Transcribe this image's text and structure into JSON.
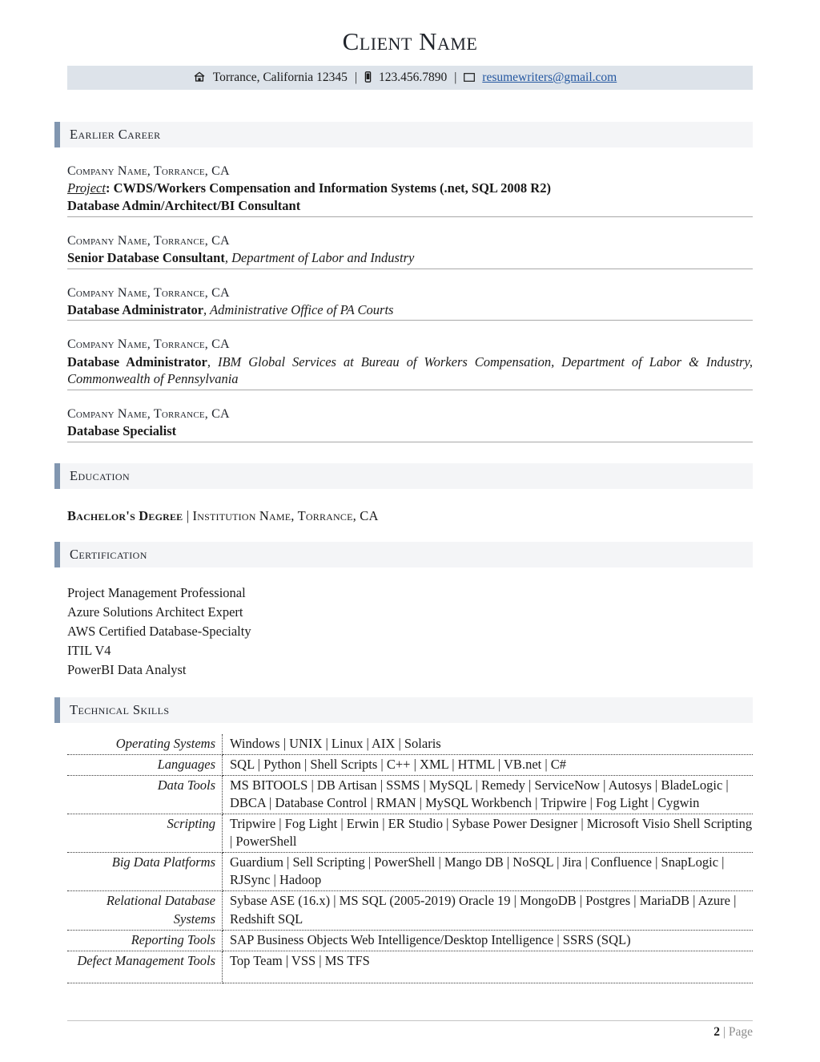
{
  "header": {
    "name": "Client Name",
    "contact": {
      "address": "Torrance, California 12345",
      "address_icon": "home-icon",
      "phone": "123.456.7890",
      "phone_icon": "mobile-phone-icon",
      "email": "resumewriters@gmail.com",
      "email_icon": "envelope-icon",
      "separator": "|"
    },
    "accent_color": "#8196b0",
    "band_color": "#dde3ea",
    "link_color": "#2457a0"
  },
  "sections": {
    "earlier_career": "Earlier Career",
    "education": "Education",
    "certification": "Certification",
    "technical_skills": "Technical Skills"
  },
  "jobs": [
    {
      "company": "Company Name, Torrance, CA",
      "project_label": "Project",
      "project": ": CWDS/Workers Compensation and Information Systems (.net, SQL 2008 R2)",
      "title": "Database Admin/Architect/BI Consultant",
      "department": ""
    },
    {
      "company": "Company Name, Torrance, CA",
      "project_label": "",
      "project": "",
      "title": "Senior Database Consultant",
      "department": ", Department of Labor and Industry"
    },
    {
      "company": "Company Name, Torrance, CA",
      "project_label": "",
      "project": "",
      "title": "Database Administrator",
      "department": ", Administrative Office of PA Courts"
    },
    {
      "company": "Company Name, Torrance, CA",
      "project_label": "",
      "project": "",
      "title": "Database Administrator",
      "department": ", IBM Global Services at Bureau of Workers Compensation, Department of Labor & Industry, Commonwealth of Pennsylvania"
    },
    {
      "company": "Company Name, Torrance, CA",
      "project_label": "",
      "project": "",
      "title": "Database Specialist",
      "department": ""
    }
  ],
  "education": {
    "degree": "Bachelor's Degree",
    "separator": " | ",
    "institution": "Institution Name, Torrance, CA"
  },
  "certifications": [
    "Project Management Professional",
    "Azure Solutions Architect Expert",
    "AWS Certified Database-Specialty",
    "ITIL V4",
    "PowerBI Data Analyst"
  ],
  "skills": [
    {
      "label": "Operating Systems",
      "value": "Windows | UNIX | Linux | AIX | Solaris"
    },
    {
      "label": "Languages",
      "value": "SQL | Python | Shell Scripts | C++ | XML | HTML | VB.net | C#"
    },
    {
      "label": "Data Tools",
      "value": "MS BITOOLS | DB Artisan | SSMS | MySQL | Remedy | ServiceNow | Autosys | BladeLogic | DBCA | Database Control | RMAN | MySQL Workbench | Tripwire | Fog Light | Cygwin"
    },
    {
      "label": "Scripting",
      "value": "Tripwire | Fog Light | Erwin | ER Studio | Sybase Power Designer | Microsoft Visio Shell Scripting | PowerShell"
    },
    {
      "label": "Big Data Platforms",
      "value": "Guardium | Sell Scripting | PowerShell | Mango DB | NoSQL | Jira | Confluence | SnapLogic | RJSync | Hadoop"
    },
    {
      "label": "Relational Database Systems",
      "value": "Sybase ASE (16.x) | MS SQL (2005-2019) Oracle 19 | MongoDB | Postgres | MariaDB | Azure | Redshift SQL"
    },
    {
      "label": "Reporting Tools",
      "value": "SAP Business Objects Web Intelligence/Desktop Intelligence | SSRS (SQL)"
    },
    {
      "label": "Defect Management Tools",
      "value": "Top Team | VSS | MS TFS"
    }
  ],
  "footer": {
    "page_number": "2",
    "separator": " | ",
    "page_word": "Page"
  }
}
